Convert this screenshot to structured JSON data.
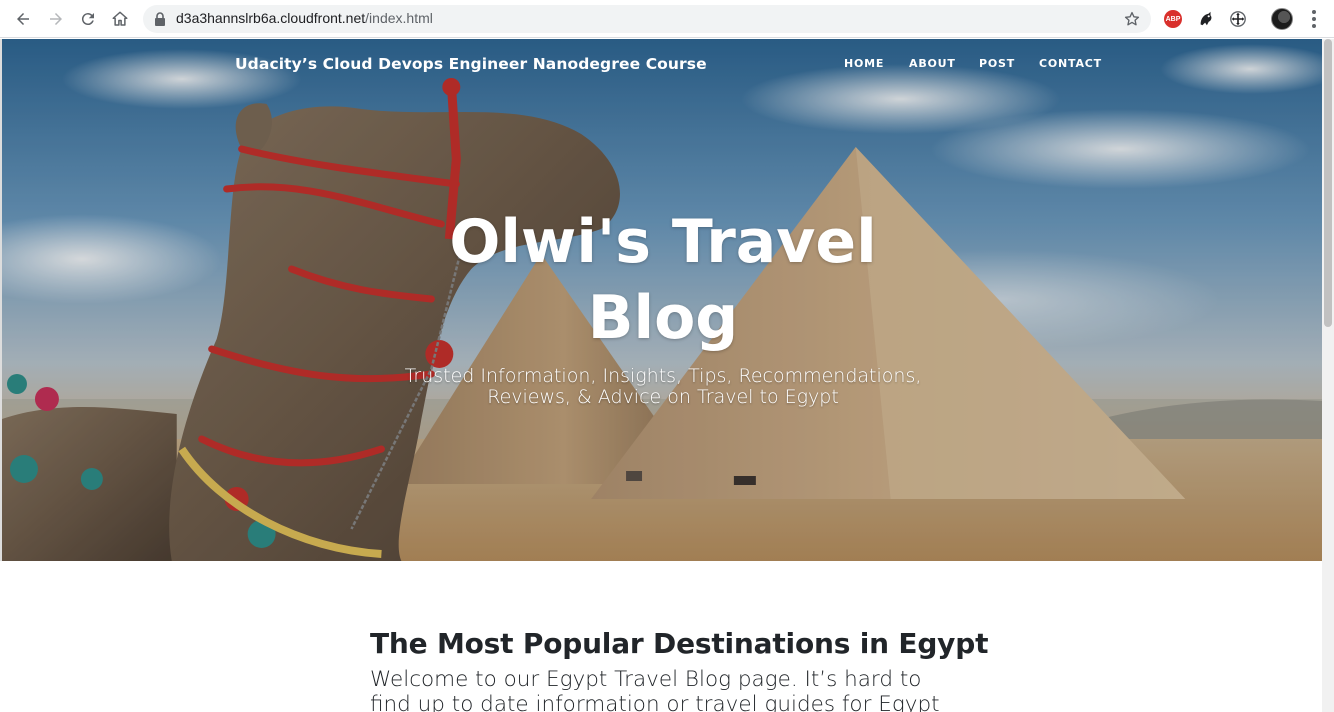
{
  "browser": {
    "url_host": "d3a3hannslrb6a.cloudfront.net",
    "url_path": "/index.html",
    "extensions": [
      "adblock-plus-icon",
      "puzzle-bird-icon",
      "move-arrows-icon"
    ],
    "abp_label": "ABP"
  },
  "navbar": {
    "brand": "Udacity’s Cloud Devops Engineer Nanodegree Course",
    "links": [
      {
        "label": "HOME"
      },
      {
        "label": "ABOUT"
      },
      {
        "label": "POST"
      },
      {
        "label": "CONTACT"
      }
    ]
  },
  "hero": {
    "title": "Olwi's Travel Blog",
    "subtitle": "Trusted Information, Insights, Tips, Recommendations, Reviews, & Advice on Travel to Egypt"
  },
  "main": {
    "heading": "The Most Popular Destinations in Egypt",
    "intro": "Welcome to our Egypt Travel Blog page. It’s hard to find up to date information or travel guides for Egypt because"
  },
  "colors": {
    "chrome_bg": "#ffffff",
    "omnibox_bg": "#f1f3f4",
    "text_dark": "#212529",
    "sky_top": "#4a7fae",
    "sand": "#c9a77c"
  }
}
